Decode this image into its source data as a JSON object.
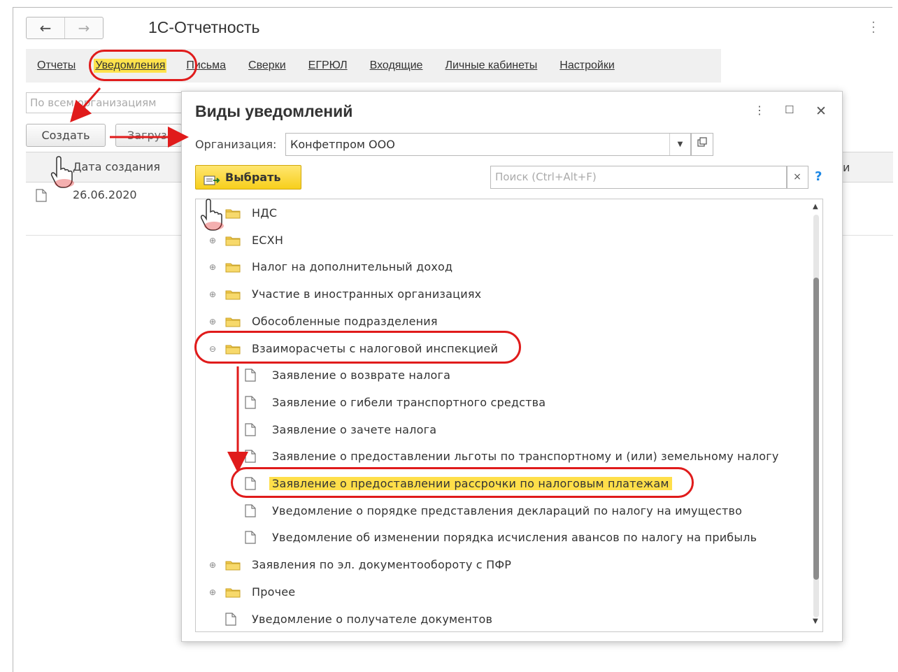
{
  "app": {
    "title": "1С-Отчетность",
    "back_icon": "arrow-left-icon",
    "forward_icon": "arrow-right-icon"
  },
  "tabs": [
    {
      "label": "Отчеты"
    },
    {
      "label": "Уведомления"
    },
    {
      "label": "Письма"
    },
    {
      "label": "Сверки"
    },
    {
      "label": "ЕГРЮЛ"
    },
    {
      "label": "Входящие"
    },
    {
      "label": "Личные кабинеты"
    },
    {
      "label": "Настройки"
    }
  ],
  "main": {
    "filter_placeholder": "По всем организациям",
    "create_label": "Создать",
    "load_label": "Загрузить",
    "col_date": "Дата создания",
    "col_right": "и",
    "row_date": "26.06.2020"
  },
  "dialog": {
    "title": "Виды уведомлений",
    "org_label": "Организация:",
    "org_value": "Конфетпром ООО",
    "select_label": "Выбрать",
    "search_placeholder": "Поиск (Ctrl+Alt+F)",
    "search_clear": "×",
    "help": "?"
  },
  "tree": [
    {
      "kind": "folder",
      "level": 0,
      "label": "НДС",
      "expander": "⊕"
    },
    {
      "kind": "folder",
      "level": 0,
      "label": "ЕСХН",
      "expander": "⊕"
    },
    {
      "kind": "folder",
      "level": 0,
      "label": "Налог на дополнительный доход",
      "expander": "⊕"
    },
    {
      "kind": "folder",
      "level": 0,
      "label": "Участие в иностранных организациях",
      "expander": "⊕"
    },
    {
      "kind": "folder",
      "level": 0,
      "label": "Обособленные подразделения",
      "expander": "⊕"
    },
    {
      "kind": "folder",
      "level": 0,
      "label": "Взаиморасчеты с налоговой инспекцией",
      "expander": "⊖"
    },
    {
      "kind": "doc",
      "level": 1,
      "label": "Заявление о возврате налога"
    },
    {
      "kind": "doc",
      "level": 1,
      "label": "Заявление о гибели транспортного средства"
    },
    {
      "kind": "doc",
      "level": 1,
      "label": "Заявление о зачете налога"
    },
    {
      "kind": "doc",
      "level": 1,
      "label": "Заявление о предоставлении льготы по транспортному и (или) земельному налогу"
    },
    {
      "kind": "doc",
      "level": 1,
      "label": "Заявление о предоставлении рассрочки по налоговым платежам",
      "selected": true
    },
    {
      "kind": "doc",
      "level": 1,
      "label": "Уведомление о порядке представления деклараций по налогу на имущество"
    },
    {
      "kind": "doc",
      "level": 1,
      "label": "Уведомление об изменении порядка исчисления авансов по налогу на прибыль"
    },
    {
      "kind": "folder",
      "level": 0,
      "label": "Заявления по эл. документообороту с ПФР",
      "expander": "⊕"
    },
    {
      "kind": "folder",
      "level": 0,
      "label": "Прочее",
      "expander": "⊕"
    },
    {
      "kind": "doc",
      "level": 0,
      "label": "Уведомление о получателе документов"
    }
  ],
  "colors": {
    "accent_yellow": "#ffdf4a",
    "annotation_red": "#e01b1b",
    "folder_yellow": "#f2c94c"
  }
}
